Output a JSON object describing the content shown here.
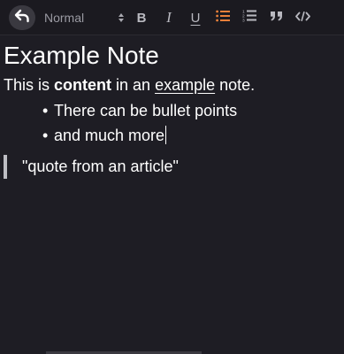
{
  "toolbar": {
    "block_type": "Normal",
    "bold_label": "B",
    "italic_label": "I",
    "underline_label": "U",
    "icons": {
      "back": "undo-arrow-icon",
      "bulleted_list": "bulleted-list-icon",
      "numbered_list": "numbered-list-icon",
      "quote": "quote-icon",
      "code": "code-icon",
      "select_arrows": "updown-chevron-icon"
    },
    "active_color": "#e8803a"
  },
  "note": {
    "title": "Example Note",
    "paragraph": {
      "before": "This is ",
      "bold": "content",
      "middle": " in an ",
      "underline": "example",
      "after": " note."
    },
    "bullet_glyph": "•",
    "bullets": [
      "There can be bullet points",
      "and much more"
    ],
    "quote": "\"quote from an article\""
  }
}
